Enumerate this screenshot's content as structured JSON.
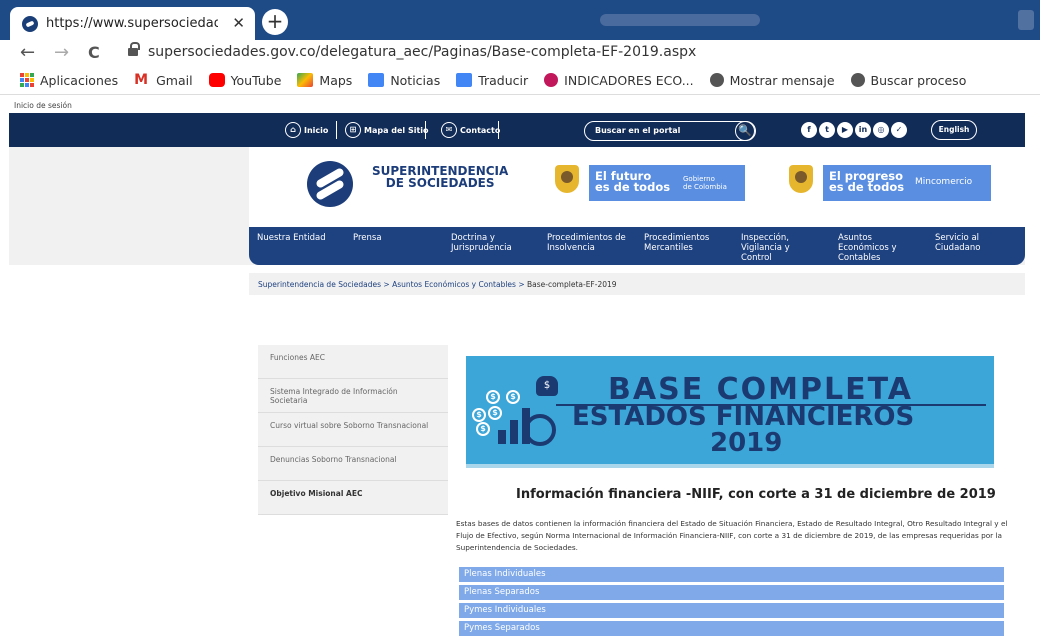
{
  "browser": {
    "tab_title": "https://www.supersociedades.go",
    "tab_close": "✕",
    "new_tab": "+",
    "back": "←",
    "forward": "→",
    "reload": "C",
    "url": "supersociedades.gov.co/delegatura_aec/Paginas/Base-completa-EF-2019.aspx",
    "bookmarks": [
      {
        "label": "Aplicaciones",
        "icon": "apps-grid-icon"
      },
      {
        "label": "Gmail",
        "icon": "gmail-icon",
        "color": "#d93025"
      },
      {
        "label": "YouTube",
        "icon": "youtube-icon",
        "color": "#ff0000"
      },
      {
        "label": "Maps",
        "icon": "maps-icon",
        "color": "#34a853"
      },
      {
        "label": "Noticias",
        "icon": "news-icon",
        "color": "#4285f4"
      },
      {
        "label": "Traducir",
        "icon": "translate-icon",
        "color": "#4285f4"
      },
      {
        "label": "INDICADORES ECO...",
        "icon": "indicadores-icon",
        "color": "#c2185b"
      },
      {
        "label": "Mostrar mensaje",
        "icon": "globe-icon",
        "color": "#555555"
      },
      {
        "label": "Buscar proceso",
        "icon": "globe-icon",
        "color": "#555555"
      }
    ]
  },
  "page": {
    "session": "Inicio de sesión",
    "topnav": {
      "inicio": "Inicio",
      "mapa": "Mapa del Sitio",
      "contacto": "Contacto",
      "search_label": "Buscar en el portal",
      "search_icon": "🔍",
      "english": "English",
      "social": [
        "f",
        "t",
        "▶",
        "in",
        "◎",
        "✓"
      ]
    },
    "header": {
      "logo_line1": "SUPERINTENDENCIA",
      "logo_line2": "DE SOCIEDADES",
      "banner1_big1": "El futuro",
      "banner1_big2": "es de todos",
      "banner1_small1": "Gobierno",
      "banner1_small2": "de Colombia",
      "banner2_big1": "El progreso",
      "banner2_big2": "es de todos",
      "banner2_small": "Mincomercio"
    },
    "mainnav": [
      {
        "l1": "Nuestra Entidad",
        "l2": "",
        "l3": ""
      },
      {
        "l1": "Prensa",
        "l2": "",
        "l3": ""
      },
      {
        "l1": "Doctrina y",
        "l2": "Jurisprudencia",
        "l3": ""
      },
      {
        "l1": "Procedimientos de",
        "l2": "Insolvencia",
        "l3": ""
      },
      {
        "l1": "Procedimientos",
        "l2": "Mercantiles",
        "l3": ""
      },
      {
        "l1": "Inspección,",
        "l2": "Vigilancia y",
        "l3": "Control"
      },
      {
        "l1": "Asuntos",
        "l2": "Económicos y",
        "l3": "Contables"
      },
      {
        "l1": "Servicio al",
        "l2": "Ciudadano",
        "l3": ""
      }
    ],
    "breadcrumb": {
      "c1": "Superintendencia de Sociedades",
      "sep": " > ",
      "c2": "Asuntos Económicos y Contables",
      "c3": "Base-completa-EF-2019"
    },
    "sidebar": [
      "Funciones AEC",
      "Sistema Integrado de Información Societaria",
      "Curso virtual sobre Soborno Transnacional",
      "Denuncias Soborno Transnacional",
      "Objetivo Misional AEC"
    ],
    "hero": {
      "line1": "BASE COMPLETA",
      "line2": "ESTADOS FINANCIEROS",
      "line3": "2019",
      "coin": "$"
    },
    "heading": "Información financiera -NIIF, con corte a 31 de diciembre de 2019",
    "description": "Estas bases de datos contienen la información financiera del Estado de Situación Financiera, Estado de Resultado Integral, Otro Resultado Integral y el Flujo de Efectivo, según Norma Internacional de Información Financiera-NIIF, con corte a 31 de diciembre de 2019, de las empresas requeridas por la Superintendencia de Sociedades.",
    "links": [
      "Plenas Individuales",
      "Plenas Separados",
      "Pymes Individuales",
      "Pymes Separados"
    ]
  }
}
